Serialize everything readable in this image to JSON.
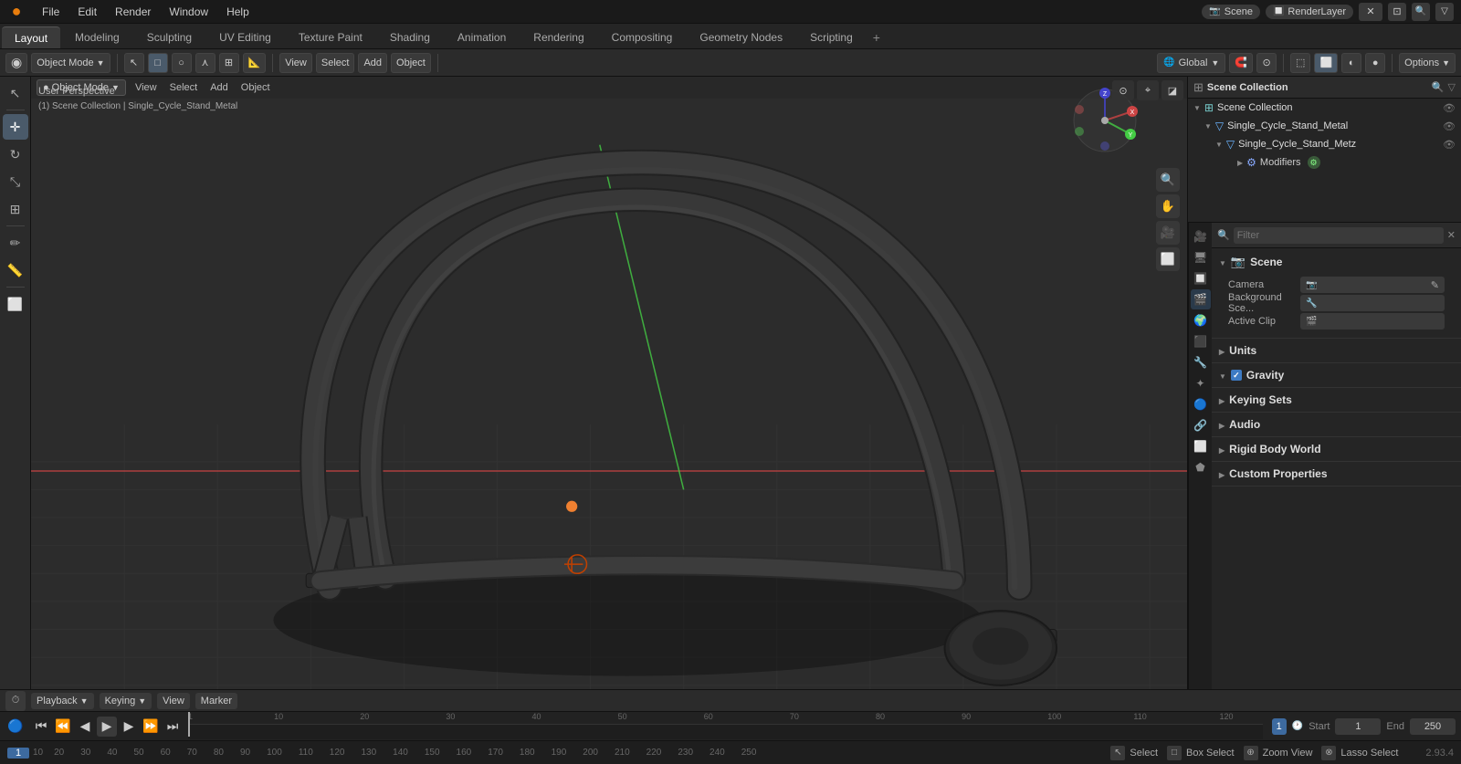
{
  "app": {
    "title": "Blender",
    "logo": "●"
  },
  "top_menu": {
    "items": [
      "Blender",
      "File",
      "Edit",
      "Render",
      "Window",
      "Help"
    ]
  },
  "workspace_tabs": {
    "tabs": [
      "Layout",
      "Modeling",
      "Sculpting",
      "UV Editing",
      "Texture Paint",
      "Shading",
      "Animation",
      "Rendering",
      "Compositing",
      "Geometry Nodes",
      "Scripting"
    ],
    "active": "Layout",
    "add_label": "+"
  },
  "header_toolbar": {
    "mode_label": "Object Mode",
    "view_label": "View",
    "select_label": "Select",
    "add_label": "Add",
    "object_label": "Object",
    "global_label": "Global",
    "options_label": "Options"
  },
  "viewport": {
    "perspective_label": "User Perspective",
    "collection_label": "(1) Scene Collection | Single_Cycle_Stand_Metal",
    "header_items": [
      "Object Mode",
      "View",
      "Select",
      "Add",
      "Object"
    ]
  },
  "outliner": {
    "title": "Scene Collection",
    "items": [
      {
        "name": "Single_Cycle_Stand_Metal",
        "indent": 0,
        "icon": "▽",
        "type": "mesh",
        "visible": true
      },
      {
        "name": "Single_Cycle_Stand_Metz",
        "indent": 1,
        "icon": "▽",
        "type": "mesh",
        "visible": true
      },
      {
        "name": "Modifiers",
        "indent": 2,
        "icon": "⚙",
        "type": "modifier",
        "visible": true
      }
    ]
  },
  "properties": {
    "active_tab": "scene",
    "tabs": [
      "render",
      "output",
      "view_layer",
      "scene",
      "world",
      "object",
      "modifier",
      "particles",
      "physics",
      "constraints",
      "data",
      "material",
      "render_engine"
    ],
    "scene_section": {
      "label": "Scene",
      "camera_label": "Camera",
      "bg_scene_label": "Background Sce...",
      "active_clip_label": "Active Clip"
    },
    "sections": [
      {
        "label": "Units",
        "expanded": false
      },
      {
        "label": "Gravity",
        "expanded": true,
        "has_checkbox": true,
        "checkbox_on": true
      },
      {
        "label": "Keying Sets",
        "expanded": false
      },
      {
        "label": "Audio",
        "expanded": false
      },
      {
        "label": "Rigid Body World",
        "expanded": false
      },
      {
        "label": "Custom Properties",
        "expanded": false
      }
    ]
  },
  "timeline": {
    "header_items": [
      "Playback",
      "Keying",
      "View",
      "Marker"
    ],
    "current_frame": "1",
    "start_label": "Start",
    "start_value": "1",
    "end_label": "End",
    "end_value": "250",
    "tick_marks": [
      "1",
      "10",
      "20",
      "30",
      "40",
      "50",
      "60",
      "70",
      "80",
      "90",
      "100",
      "110",
      "120",
      "130",
      "140",
      "150",
      "160",
      "170",
      "180",
      "190",
      "200",
      "210",
      "220",
      "230",
      "240",
      "250"
    ]
  },
  "bottom_bar": {
    "tools": [
      {
        "icon": "↖",
        "label": "Select"
      },
      {
        "icon": "□",
        "label": "Box Select"
      },
      {
        "icon": "⊕",
        "label": "Zoom View"
      },
      {
        "icon": "⊗",
        "label": "Lasso Select"
      }
    ],
    "version": "2.93.4"
  }
}
